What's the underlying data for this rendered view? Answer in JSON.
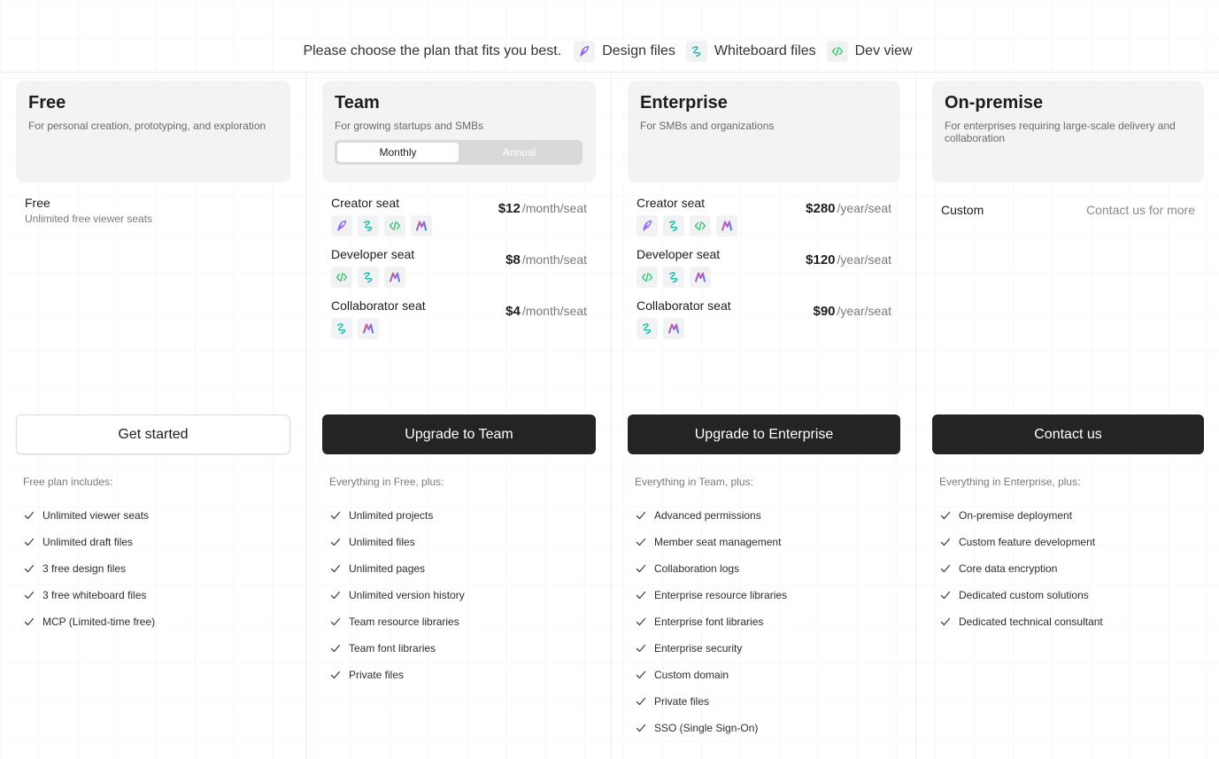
{
  "header": {
    "prompt": "Please choose the plan that fits you best.",
    "legend": [
      {
        "icon": "pen-icon",
        "label": "Design files"
      },
      {
        "icon": "whiteboard-icon",
        "label": "Whiteboard files"
      },
      {
        "icon": "code-icon",
        "label": "Dev view"
      }
    ]
  },
  "colors": {
    "pen": "#8b5cf6",
    "whiteboard": "#14b8a6",
    "code": "#22c55e",
    "ai_a": "#ec4899",
    "ai_b": "#3b82f6",
    "dark_button": "#242424"
  },
  "plans": [
    {
      "name": "Free",
      "description": "For personal creation, prototyping, and exploration",
      "free_title": "Free",
      "free_sub": "Unlimited free viewer seats",
      "cta": "Get started",
      "features_heading": "Free plan includes:",
      "features": [
        "Unlimited viewer seats",
        "Unlimited draft files",
        "3 free design files",
        "3 free whiteboard files",
        "MCP (Limited-time free)"
      ]
    },
    {
      "name": "Team",
      "description": "For growing startups and SMBs",
      "toggle": {
        "monthly": "Monthly",
        "annual": "Annual",
        "selected": "Monthly"
      },
      "seats": [
        {
          "name": "Creator seat",
          "price": "$12",
          "unit": "/month/seat",
          "icons": [
            "pen-icon",
            "whiteboard-icon",
            "code-icon",
            "ai-icon"
          ]
        },
        {
          "name": "Developer seat",
          "price": "$8",
          "unit": "/month/seat",
          "icons": [
            "code-icon",
            "whiteboard-icon",
            "ai-icon"
          ]
        },
        {
          "name": "Collaborator seat",
          "price": "$4",
          "unit": "/month/seat",
          "icons": [
            "whiteboard-icon",
            "ai-icon"
          ]
        }
      ],
      "cta": "Upgrade to Team",
      "features_heading": "Everything in Free, plus:",
      "features": [
        "Unlimited projects",
        "Unlimited files",
        "Unlimited pages",
        "Unlimited version history",
        "Team resource libraries",
        "Team font libraries",
        "Private files"
      ]
    },
    {
      "name": "Enterprise",
      "description": "For SMBs and organizations",
      "seats": [
        {
          "name": "Creator seat",
          "price": "$280",
          "unit": "/year/seat",
          "icons": [
            "pen-icon",
            "whiteboard-icon",
            "code-icon",
            "ai-icon"
          ]
        },
        {
          "name": "Developer seat",
          "price": "$120",
          "unit": "/year/seat",
          "icons": [
            "code-icon",
            "whiteboard-icon",
            "ai-icon"
          ]
        },
        {
          "name": "Collaborator seat",
          "price": "$90",
          "unit": "/year/seat",
          "icons": [
            "whiteboard-icon",
            "ai-icon"
          ]
        }
      ],
      "cta": "Upgrade to Enterprise",
      "features_heading": "Everything in Team, plus:",
      "features": [
        "Advanced permissions",
        "Member seat management",
        "Collaboration logs",
        "Enterprise resource libraries",
        "Enterprise font libraries",
        "Enterprise security",
        "Custom domain",
        "Private files",
        "SSO (Single Sign-On)"
      ]
    },
    {
      "name": "On-premise",
      "description": "For enterprises requiring large-scale delivery and collaboration",
      "custom_title": "Custom",
      "custom_contact": "Contact us for more",
      "cta": "Contact us",
      "features_heading": "Everything in Enterprise, plus:",
      "features": [
        "On-premise deployment",
        "Custom feature development",
        "Core data encryption",
        "Dedicated custom solutions",
        "Dedicated technical consultant"
      ]
    }
  ]
}
